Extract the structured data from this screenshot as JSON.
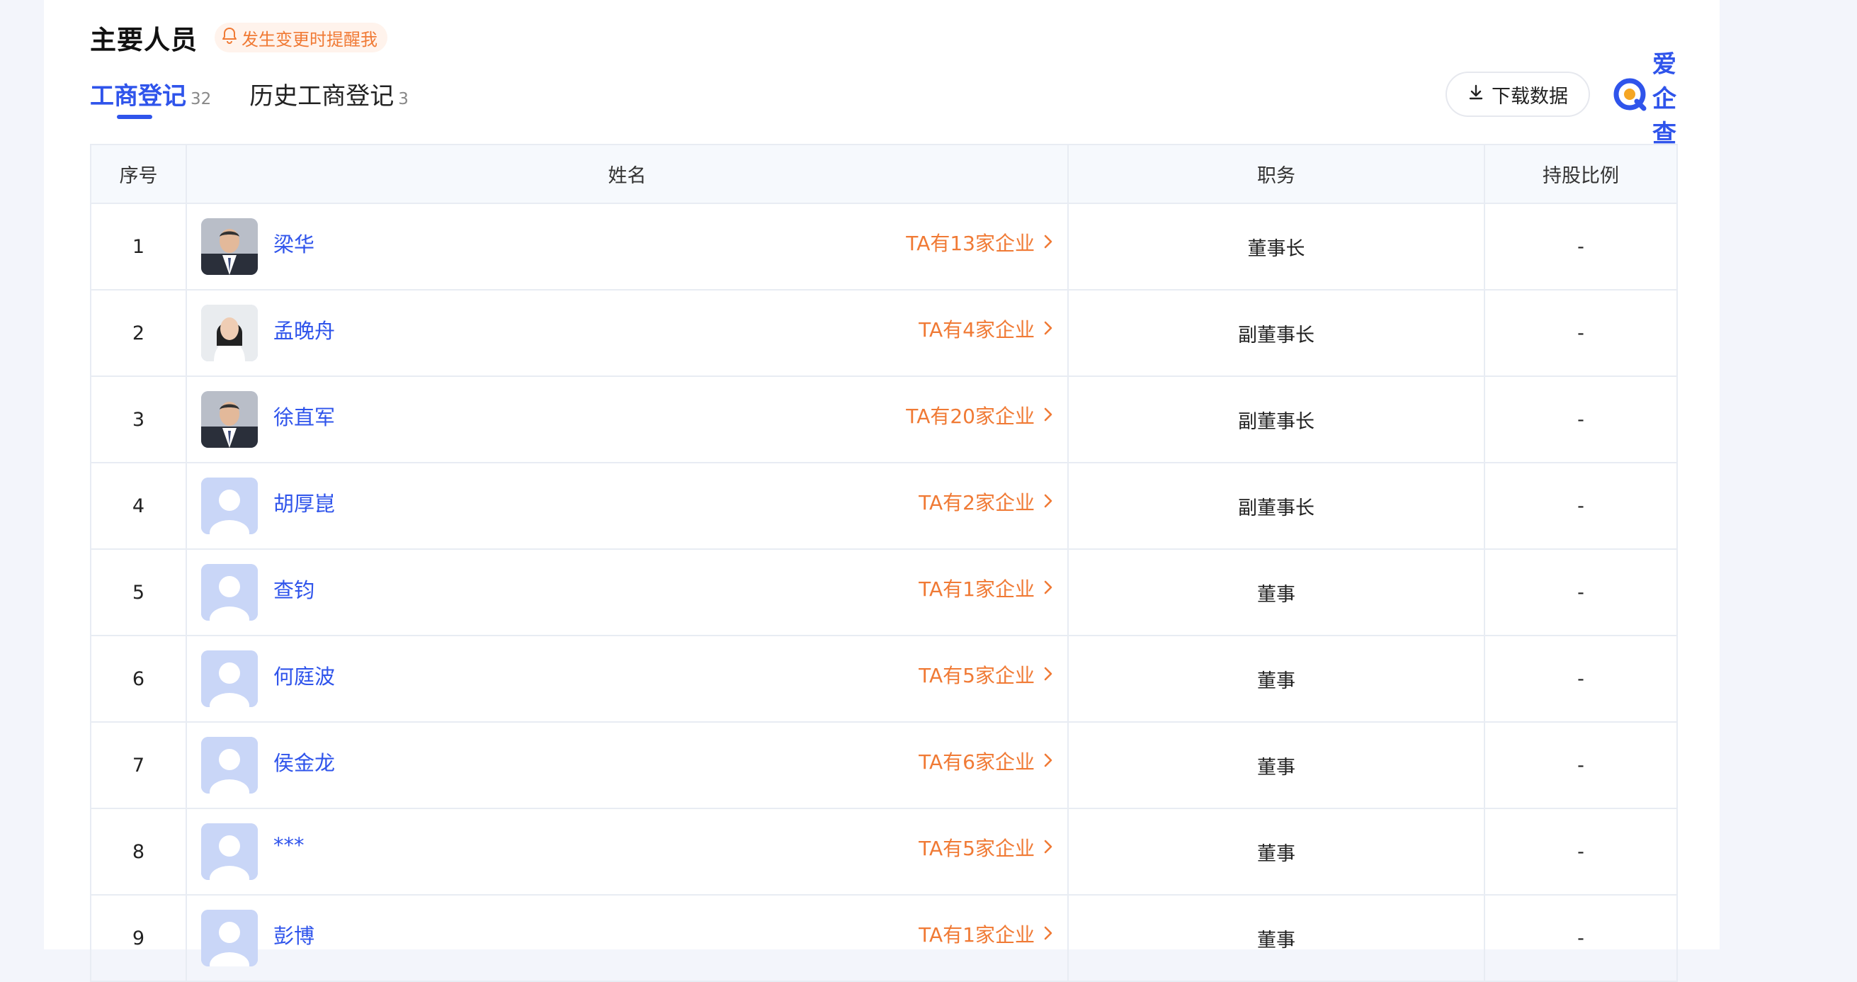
{
  "section": {
    "title": "主要人员",
    "remind_label": "发生变更时提醒我"
  },
  "tabs": [
    {
      "label": "工商登记",
      "count": "32",
      "active": true
    },
    {
      "label": "历史工商登记",
      "count": "3",
      "active": false
    }
  ],
  "toolbar": {
    "download_label": "下载数据",
    "logo_text": "爱企查"
  },
  "table": {
    "headers": [
      "序号",
      "姓名",
      "职务",
      "持股比例"
    ],
    "rows": [
      {
        "index": "1",
        "name": "梁华",
        "companies": "TA有13家企业",
        "position": "董事长",
        "share": "-",
        "avatar": "photo-male"
      },
      {
        "index": "2",
        "name": "孟晚舟",
        "companies": "TA有4家企业",
        "position": "副董事长",
        "share": "-",
        "avatar": "photo-female"
      },
      {
        "index": "3",
        "name": "徐直军",
        "companies": "TA有20家企业",
        "position": "副董事长",
        "share": "-",
        "avatar": "photo-male"
      },
      {
        "index": "4",
        "name": "胡厚崑",
        "companies": "TA有2家企业",
        "position": "副董事长",
        "share": "-",
        "avatar": "placeholder"
      },
      {
        "index": "5",
        "name": "查钧",
        "companies": "TA有1家企业",
        "position": "董事",
        "share": "-",
        "avatar": "placeholder"
      },
      {
        "index": "6",
        "name": "何庭波",
        "companies": "TA有5家企业",
        "position": "董事",
        "share": "-",
        "avatar": "placeholder"
      },
      {
        "index": "7",
        "name": "侯金龙",
        "companies": "TA有6家企业",
        "position": "董事",
        "share": "-",
        "avatar": "placeholder"
      },
      {
        "index": "8",
        "name": "***",
        "companies": "TA有5家企业",
        "position": "董事",
        "share": "-",
        "avatar": "placeholder"
      },
      {
        "index": "9",
        "name": "彭博",
        "companies": "TA有1家企业",
        "position": "董事",
        "share": "-",
        "avatar": "placeholder"
      }
    ]
  },
  "colors": {
    "accent_blue": "#2f54eb",
    "accent_orange": "#f07a35",
    "page_bg": "#f3f5fb"
  },
  "icons": [
    "bell-icon",
    "download-icon",
    "logo-icon",
    "chevron-right-icon",
    "avatar-placeholder-icon"
  ]
}
